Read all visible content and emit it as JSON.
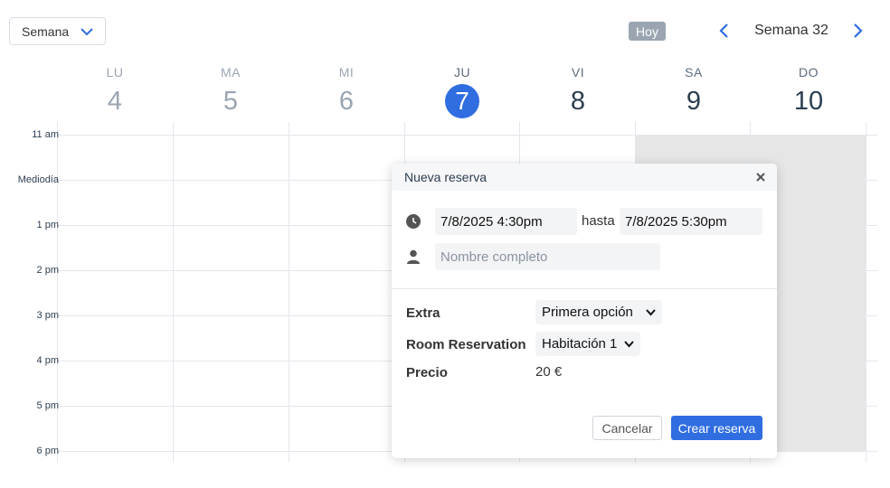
{
  "toolbar": {
    "view_select": "Semana",
    "today_label": "Hoy",
    "week_label": "Semana 32"
  },
  "days": [
    {
      "name": "LU",
      "num": "4"
    },
    {
      "name": "MA",
      "num": "5"
    },
    {
      "name": "MI",
      "num": "6"
    },
    {
      "name": "JU",
      "num": "7"
    },
    {
      "name": "VI",
      "num": "8"
    },
    {
      "name": "SA",
      "num": "9"
    },
    {
      "name": "DO",
      "num": "10"
    }
  ],
  "times": [
    "11 am",
    "Mediodía",
    "1 pm",
    "2 pm",
    "3 pm",
    "4 pm",
    "5 pm",
    "6 pm"
  ],
  "modal": {
    "title": "Nueva reserva",
    "start": "7/8/2025 4:30pm",
    "hasta": "hasta",
    "end": "7/8/2025 5:30pm",
    "name_placeholder": "Nombre completo",
    "extra_label": "Extra",
    "extra_value": "Primera opción",
    "room_label": "Room Reservation",
    "room_value": "Habitación 1",
    "price_label": "Precio",
    "price_value": "20 €",
    "cancel": "Cancelar",
    "create": "Crear reserva"
  },
  "colors": {
    "accent": "#2f6de1",
    "today_button": "#9aa5b1",
    "blocked": "#e6e6e6"
  }
}
